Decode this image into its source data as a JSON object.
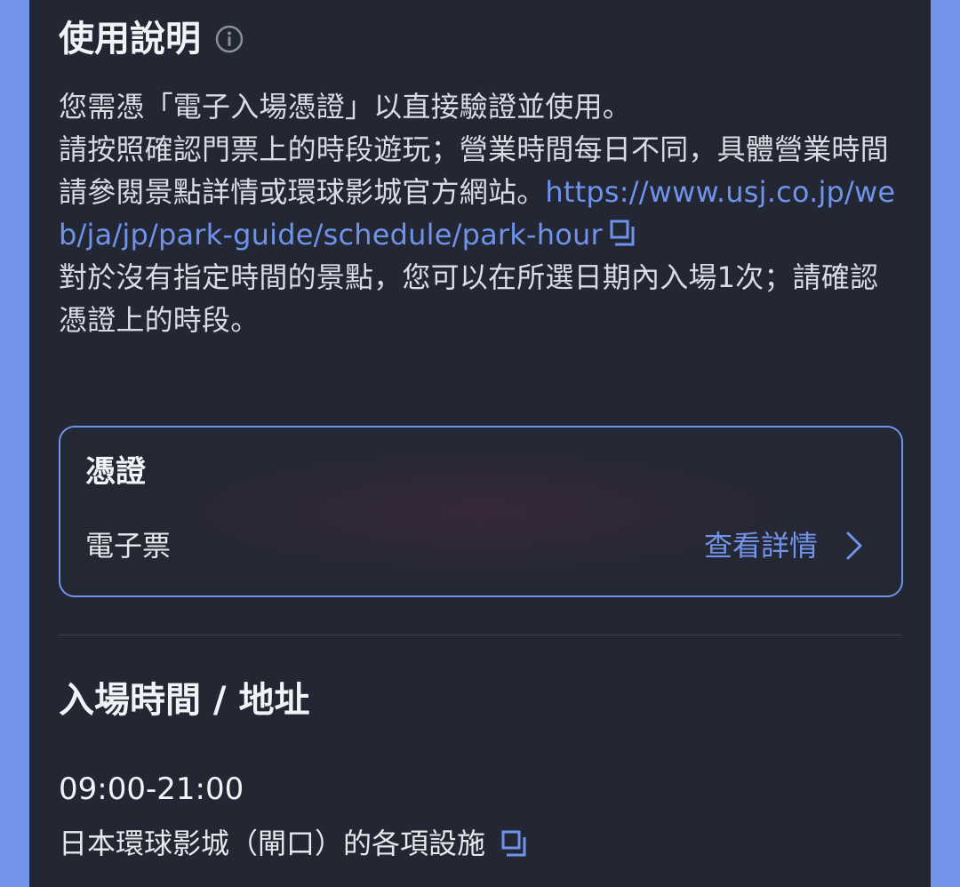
{
  "usage": {
    "title": "使用說明",
    "info_icon": "info-icon",
    "line1": "您需憑「電子入場憑證」以直接驗證並使用。",
    "line2": "請按照確認門票上的時段遊玩；營業時間每日不同，具體營業時間請參閱景點詳情或環球影城官方網站。",
    "link": "https://www.usj.co.jp/web/ja/jp/park-guide/schedule/park-hour",
    "link_icon": "external-link-icon",
    "line3": "對於沒有指定時間的景點，您可以在所選日期內入場1次；請確認憑證上的時段。"
  },
  "voucher": {
    "title": "憑證",
    "type": "電子票",
    "details_label": "查看詳情",
    "chevron_icon": "chevron-right-icon"
  },
  "entry": {
    "title": "入場時間 / 地址",
    "hours": "09:00-21:00",
    "address": "日本環球影城（閘口）的各項設施",
    "address_icon": "external-link-icon"
  },
  "colors": {
    "background": "#232733",
    "side_accent": "#7193ea",
    "link": "#6f93ea",
    "text": "#d9dce3"
  }
}
